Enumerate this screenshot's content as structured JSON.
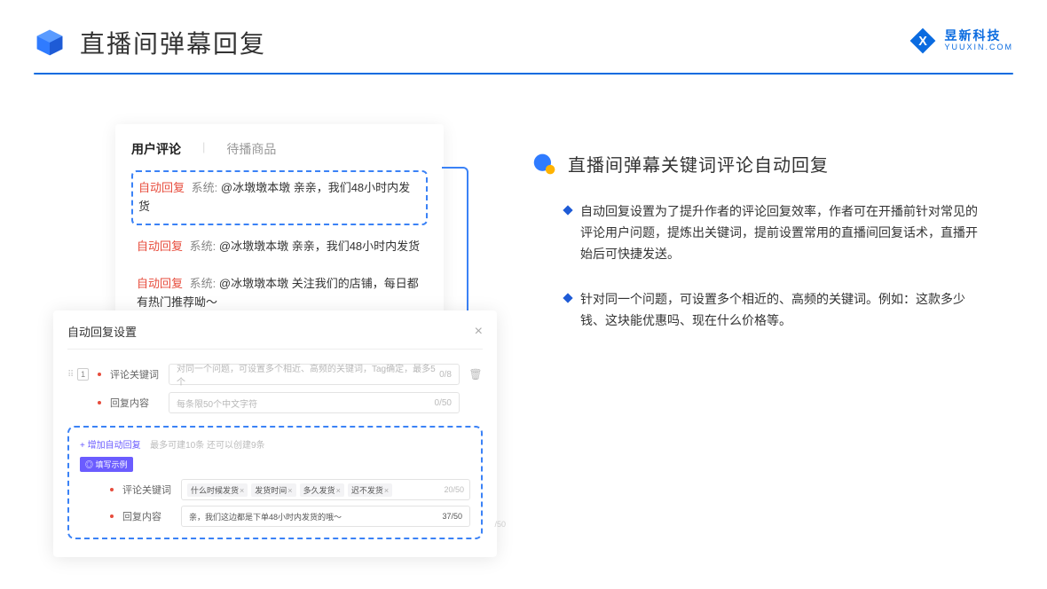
{
  "header": {
    "title": "直播间弹幕回复",
    "brand_cn": "昱新科技",
    "brand_en": "YUUXIN.COM"
  },
  "comments_card": {
    "tab_active": "用户评论",
    "tab_inactive": "待播商品",
    "auto_badge": "自动回复",
    "sys_label": "系统:",
    "c1": "@冰墩墩本墩 亲亲，我们48小时内发货",
    "c2": "@冰墩墩本墩 亲亲，我们48小时内发货",
    "c3": "@冰墩墩本墩 关注我们的店铺，每日都有热门推荐呦～"
  },
  "settings": {
    "title": "自动回复设置",
    "index": "1",
    "label_keyword": "评论关键词",
    "label_reply": "回复内容",
    "ph_keyword": "对同一个问题，可设置多个相近、高频的关键词，Tag确定，最多5个",
    "ph_reply": "每条限50个中文字符",
    "count_kw": "0/8",
    "count_reply": "0/50",
    "add_link": "+ 增加自动回复",
    "add_hint": "最多可建10条 还可以创建9条",
    "example_badge": "◎ 填写示例",
    "ex_tags": [
      "什么时候发货",
      "发货时间",
      "多久发货",
      "迟不发货"
    ],
    "ex_kw_count": "20/50",
    "ex_reply": "亲，我们这边都是下单48小时内发货的哦～",
    "ex_reply_count": "37/50",
    "outer_count": "/50"
  },
  "right": {
    "subtitle": "直播间弹幕关键词评论自动回复",
    "b1": "自动回复设置为了提升作者的评论回复效率，作者可在开播前针对常见的评论用户问题，提炼出关键词，提前设置常用的直播间回复话术，直播开始后可快捷发送。",
    "b2": "针对同一个问题，可设置多个相近的、高频的关键词。例如：这款多少钱、这块能优惠吗、现在什么价格等。"
  }
}
